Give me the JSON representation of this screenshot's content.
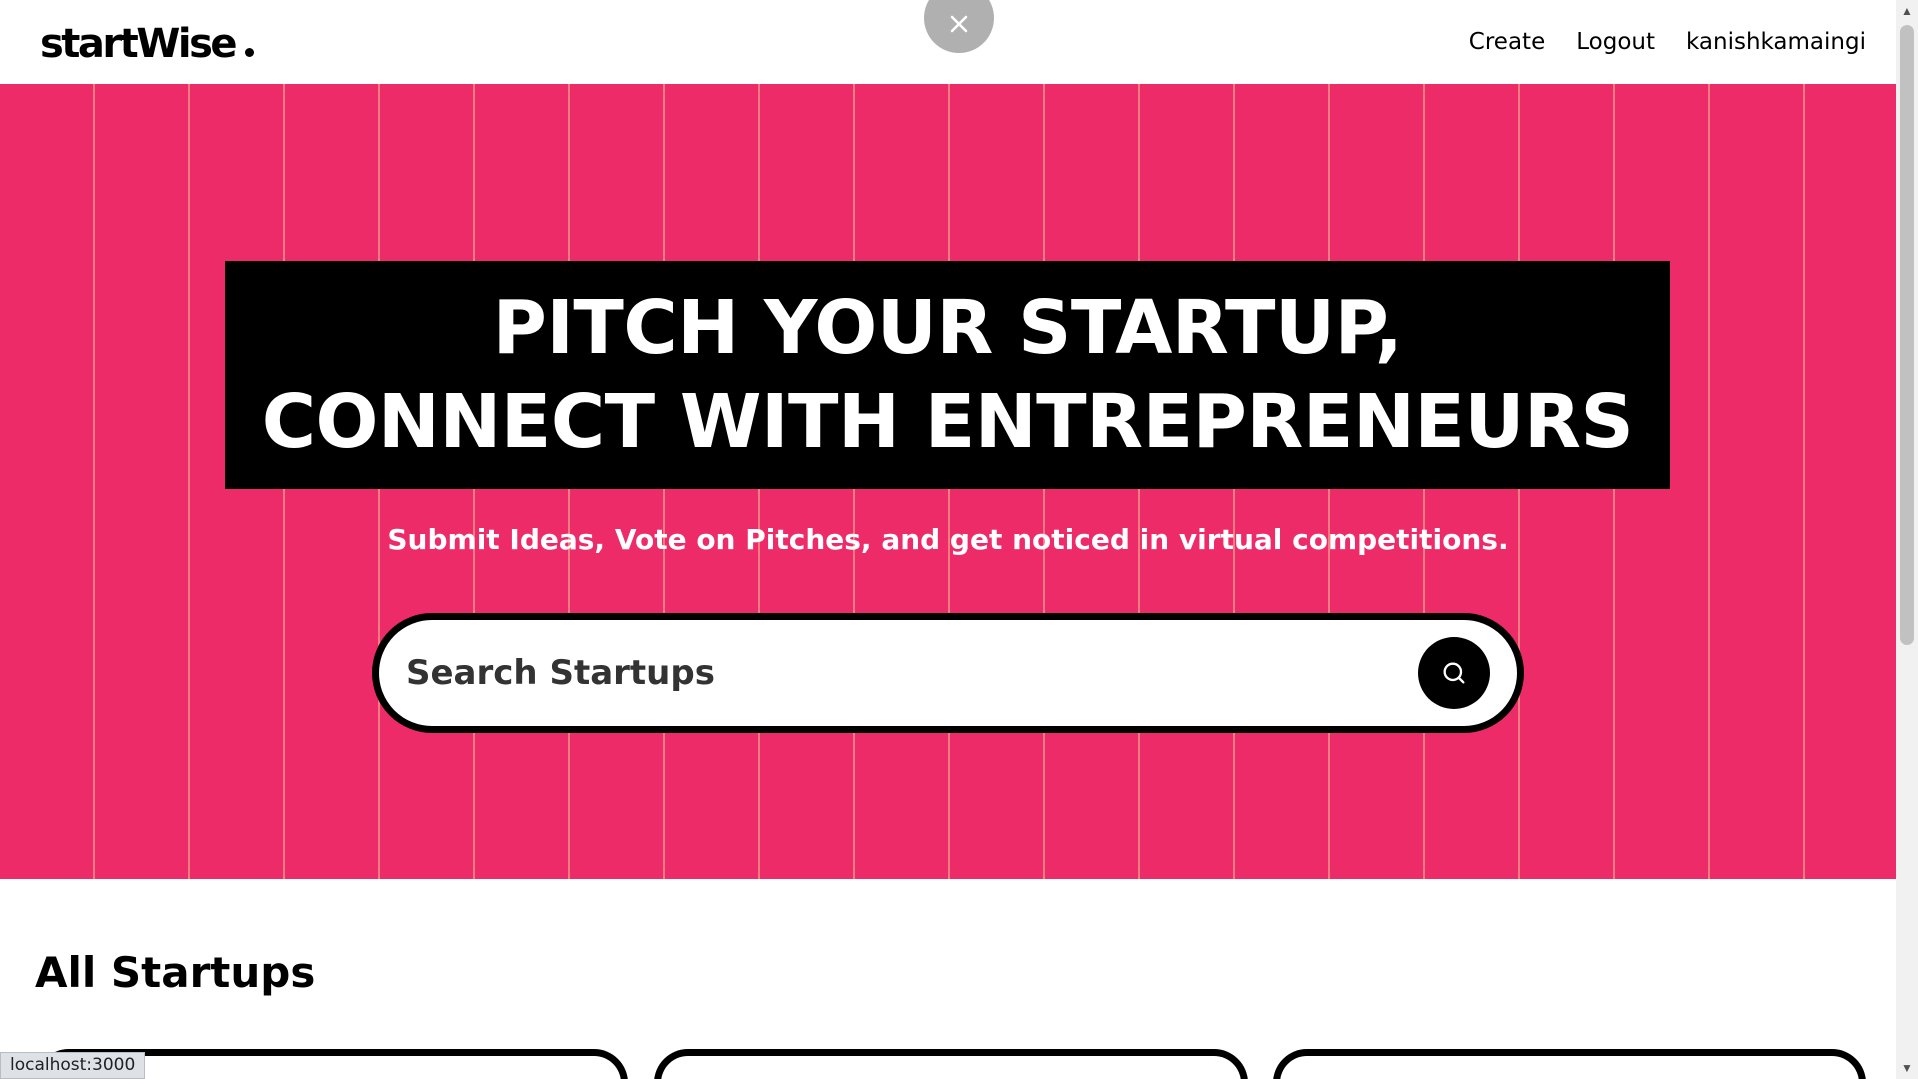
{
  "header": {
    "logo_text": "startWise",
    "nav": {
      "create": "Create",
      "logout": "Logout",
      "username": "kanishkamaingi"
    }
  },
  "hero": {
    "headline_line1": "PITCH YOUR STARTUP,",
    "headline_line2": "CONNECT WITH ENTREPRENEURS",
    "subheading": "Submit Ideas, Vote on Pitches, and get noticed in virtual competitions.",
    "search": {
      "placeholder": "Search Startups",
      "value": ""
    }
  },
  "content": {
    "section_title": "All Startups"
  },
  "status_bar": {
    "url": "localhost:3000"
  },
  "colors": {
    "accent": "#ee2b69",
    "primary": "#000000",
    "background": "#ffffff"
  },
  "icons": {
    "search": "search-icon",
    "close": "close-icon"
  }
}
